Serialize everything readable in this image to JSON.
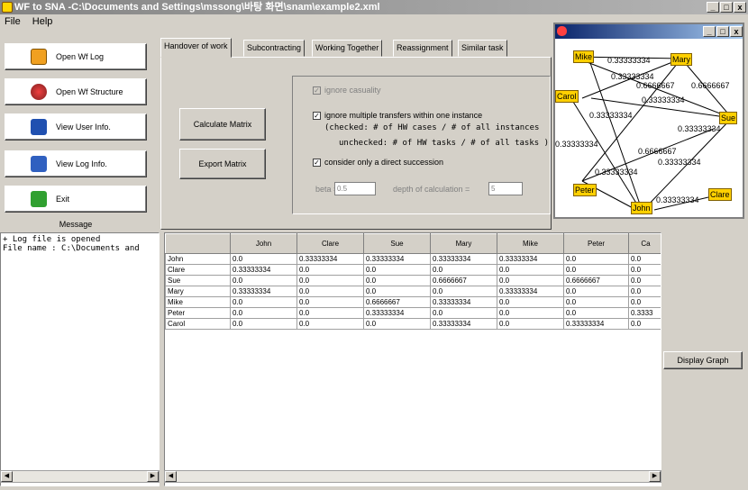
{
  "window": {
    "title": "WF to SNA -C:\\Documents and Settings\\mssong\\바탕 화면\\snam\\example2.xml",
    "minimize": "_",
    "maximize": "□",
    "close": "x"
  },
  "menu": {
    "file": "File",
    "help": "Help"
  },
  "left_buttons": {
    "open_log": "Open Wf Log",
    "open_structure": "Open Wf Structure",
    "view_user": "View User Info.",
    "view_log": "View Log Info.",
    "exit": "Exit"
  },
  "message": {
    "label": "Message",
    "line1": "+ Log file is opened",
    "line2": "File name : C:\\Documents and"
  },
  "tabs": [
    "Handover of work",
    "Subcontracting",
    "Working Together",
    "Reassignment",
    "Similar task"
  ],
  "controls": {
    "calculate": "Calculate Matrix",
    "export": "Export Matrix",
    "ignore_causality": "ignore casuality",
    "ignore_multiple": "ignore multiple transfers within one instance",
    "checked_note": "(checked: # of HW cases / # of all instances",
    "unchecked_note": "unchecked: # of HW tasks / # of all tasks )",
    "direct_succession": "consider only a direct succession",
    "beta_label": "beta =",
    "beta_value": "0.5",
    "depth_label": "depth of calculation =",
    "depth_value": "5",
    "display_graph": "Display Graph"
  },
  "matrix": {
    "columns": [
      "",
      "John",
      "Clare",
      "Sue",
      "Mary",
      "Mike",
      "Peter",
      "Ca"
    ],
    "rows": [
      [
        "John",
        "0.0",
        "0.33333334",
        "0.33333334",
        "0.33333334",
        "0.33333334",
        "0.0",
        "0.0"
      ],
      [
        "Clare",
        "0.33333334",
        "0.0",
        "0.0",
        "0.0",
        "0.0",
        "0.0",
        "0.0"
      ],
      [
        "Sue",
        "0.0",
        "0.0",
        "0.0",
        "0.6666667",
        "0.0",
        "0.6666667",
        "0.0"
      ],
      [
        "Mary",
        "0.33333334",
        "0.0",
        "0.0",
        "0.0",
        "0.33333334",
        "0.0",
        "0.0"
      ],
      [
        "Mike",
        "0.0",
        "0.0",
        "0.6666667",
        "0.33333334",
        "0.0",
        "0.0",
        "0.0"
      ],
      [
        "Peter",
        "0.0",
        "0.0",
        "0.33333334",
        "0.0",
        "0.0",
        "0.0",
        "0.3333"
      ],
      [
        "Carol",
        "0.0",
        "0.0",
        "0.0",
        "0.33333334",
        "0.0",
        "0.33333334",
        "0.0"
      ]
    ]
  },
  "graph": {
    "nodes": [
      "Mike",
      "Mary",
      "Carol",
      "Sue",
      "Peter",
      "John",
      "Clare"
    ],
    "edge_labels": [
      "0.33333334",
      "0.33333334",
      "0.6666667",
      "0.6666667",
      "0.33333334",
      "0.33333334",
      "0.33333334",
      "0.33333334",
      "0.6666667",
      "0.33333334",
      "0.33333334",
      "0.33333334"
    ]
  },
  "colors": {
    "node": "#ffd000",
    "titlebar": "#9c9c9c"
  }
}
